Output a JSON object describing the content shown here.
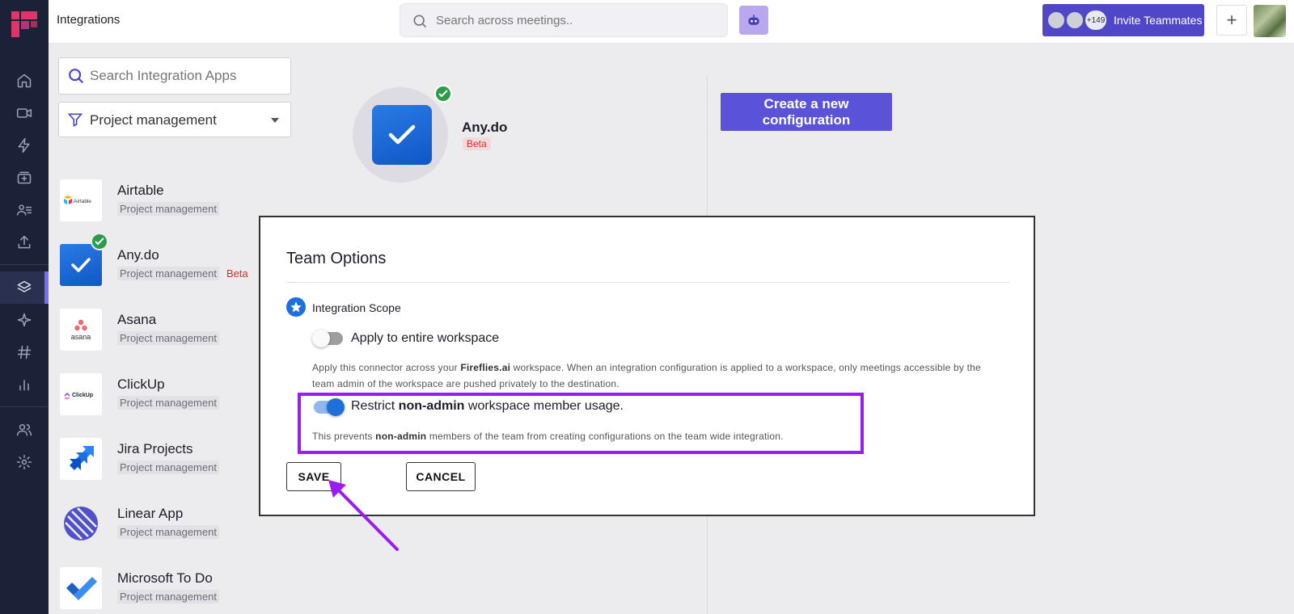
{
  "rail": {
    "icons": [
      "home-icon",
      "video-icon",
      "lightning-icon",
      "inbox-icon",
      "people-list-icon",
      "upload-icon",
      "layers-icon",
      "sparkle-icon",
      "hash-icon",
      "bar-chart-icon",
      "team-icon",
      "settings-icon"
    ],
    "active": "layers-icon"
  },
  "topbar": {
    "title": "Integrations",
    "search_placeholder": "Search across meetings..",
    "invite_count": "+149",
    "invite_label": "Invite Teammates",
    "plus": "+"
  },
  "list": {
    "search_placeholder": "Search Integration Apps",
    "filter_value": "Project management",
    "apps": [
      {
        "name": "Airtable",
        "category": "Project management",
        "badge": "",
        "logo_text": "Airtable"
      },
      {
        "name": "Any.do",
        "category": "Project management",
        "badge": "Beta",
        "logo_text": ""
      },
      {
        "name": "Asana",
        "category": "Project management",
        "badge": "",
        "logo_text": "asana"
      },
      {
        "name": "ClickUp",
        "category": "Project management",
        "badge": "",
        "logo_text": "ClickUp"
      },
      {
        "name": "Jira Projects",
        "category": "Project management",
        "badge": "",
        "logo_text": ""
      },
      {
        "name": "Linear App",
        "category": "Project management",
        "badge": "",
        "logo_text": ""
      },
      {
        "name": "Microsoft To Do",
        "category": "Project management",
        "badge": "",
        "logo_text": ""
      }
    ]
  },
  "main": {
    "app_name": "Any.do",
    "app_badge": "Beta",
    "create_button": "Create a new configuration"
  },
  "modal": {
    "title": "Team Options",
    "scope_label": "Integration Scope",
    "option1": {
      "label": "Apply to entire workspace",
      "enabled": false,
      "desc_pre": "Apply this connector across your ",
      "desc_bold": "Fireflies.ai",
      "desc_post": " workspace. When an integration configuration is applied to a workspace, only meetings accessible by the team admin of the workspace are pushed privately to the destination."
    },
    "option2": {
      "label_pre": "Restrict ",
      "label_bold": "non-admin",
      "label_post": " workspace member usage.",
      "enabled": true,
      "desc_pre": "This prevents ",
      "desc_bold": "non-admin",
      "desc_post": " members of the team from creating configurations on the team wide integration."
    },
    "save_button": "SAVE",
    "cancel_button": "CANCEL"
  },
  "colors": {
    "rail_bg": "#1b2238",
    "brand": "#4f46c8",
    "toggle_on": "#1e6fd9",
    "highlight": "#9a1cf0",
    "beta": "#d0312d"
  }
}
